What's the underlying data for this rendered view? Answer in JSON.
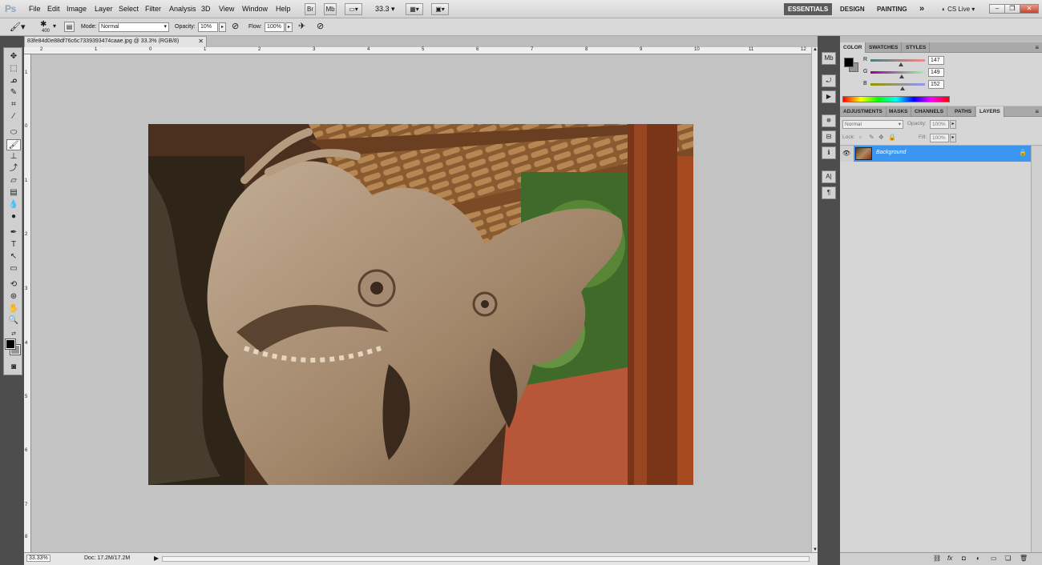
{
  "app": {
    "logo": "Ps"
  },
  "menu": {
    "items": [
      "File",
      "Edit",
      "Image",
      "Layer",
      "Select",
      "Filter",
      "Analysis",
      "3D",
      "View",
      "Window",
      "Help"
    ]
  },
  "appbar": {
    "bridge": "Br",
    "minibridge": "Mb",
    "zoom": "33.3"
  },
  "workspaces": {
    "essentials": "ESSENTIALS",
    "design": "DESIGN",
    "painting": "PAINTING",
    "more": "»",
    "cs_live": "CS Live"
  },
  "options": {
    "brush_size": "400",
    "mode_label": "Mode:",
    "mode_value": "Normal",
    "opacity_label": "Opacity:",
    "opacity_value": "10%",
    "flow_label": "Flow:",
    "flow_value": "100%"
  },
  "document": {
    "tab_title": "83fe84d0e88df76c6c7339393474caae.jpg @ 33.3% (RGB/8)",
    "zoom_status": "33.33%",
    "doc_status": "Doc: 17.2M/17.2M"
  },
  "rulers": {
    "h_ticks": [
      "2",
      "1",
      "0",
      "1",
      "2",
      "3",
      "4",
      "5",
      "6",
      "7",
      "8",
      "9",
      "10",
      "11",
      "12"
    ],
    "v_ticks": [
      "1",
      "0",
      "1",
      "2",
      "3",
      "4",
      "5",
      "6",
      "7",
      "8"
    ]
  },
  "color_panel": {
    "tabs": [
      "COLOR",
      "SWATCHES",
      "STYLES"
    ],
    "channels": [
      {
        "label": "R",
        "value": "147"
      },
      {
        "label": "G",
        "value": "149"
      },
      {
        "label": "B",
        "value": "152"
      }
    ]
  },
  "layers_panel": {
    "tabs": [
      "ADJUSTMENTS",
      "MASKS",
      "CHANNELS",
      "PATHS",
      "LAYERS"
    ],
    "blend_mode": "Normal",
    "opacity_label": "Opacity:",
    "opacity_value": "100%",
    "lock_label": "Lock:",
    "fill_label": "Fill:",
    "fill_value": "100%",
    "layer_name": "Background"
  },
  "colors": {
    "accent": "#3a96f0",
    "fg_swatch": "#000000",
    "bg_swatch": "#939598"
  }
}
